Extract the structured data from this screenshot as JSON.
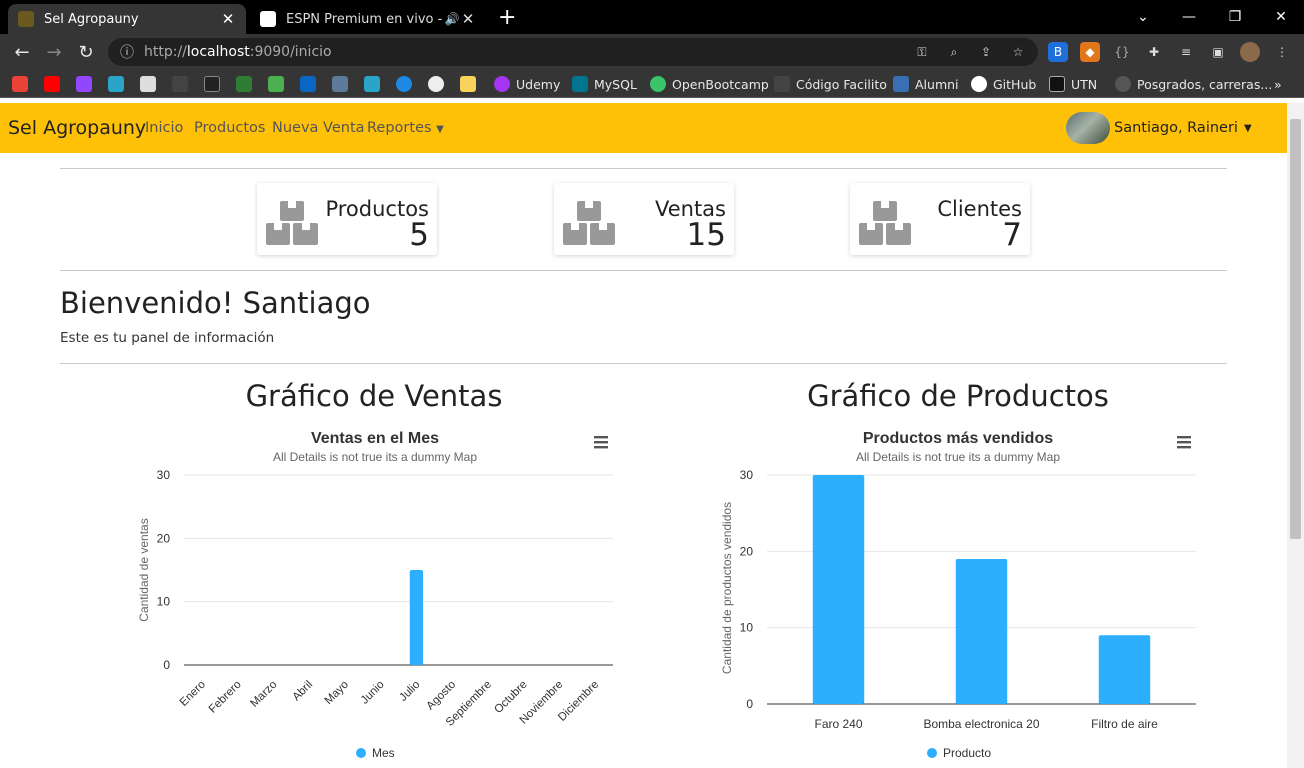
{
  "browser": {
    "tabs": [
      {
        "title": "Sel Agropauny",
        "active": true
      },
      {
        "title": "ESPN Premium en vivo - Fútb",
        "active": false
      }
    ],
    "url_scheme": "http://",
    "url_host": "localhost",
    "url_path": ":9090/inicio",
    "bookmarks": [
      "Udemy",
      "MySQL",
      "OpenBootcamp",
      "Código Facilito",
      "Alumni",
      "GitHub",
      "UTN",
      "Posgrados, carreras..."
    ]
  },
  "navbar": {
    "brand": "Sel Agropauny",
    "links": [
      "Inicio",
      "Productos",
      "Nueva Venta",
      "Reportes"
    ],
    "user": "Santiago, Raineri"
  },
  "cards": [
    {
      "label": "Productos",
      "value": "5"
    },
    {
      "label": "Ventas",
      "value": "15"
    },
    {
      "label": "Clientes",
      "value": "7"
    }
  ],
  "welcome": {
    "title": "Bienvenido! Santiago",
    "subtitle": "Este es tu panel de información"
  },
  "section_titles": {
    "ventas": "Gráfico de Ventas",
    "productos": "Gráfico de Productos"
  },
  "colors": {
    "navbar": "#ffc107",
    "series": "#2caffe"
  },
  "chart_data": [
    {
      "type": "bar",
      "title": "Ventas en el Mes",
      "subtitle": "All Details is not true its a dummy Map",
      "xlabel": "",
      "ylabel": "Cantidad de ventas",
      "ylim": [
        0,
        30
      ],
      "yticks": [
        0,
        10,
        20,
        30
      ],
      "categories": [
        "Enero",
        "Febrero",
        "Marzo",
        "Abril",
        "Mayo",
        "Junio",
        "Julio",
        "Agosto",
        "Septiembre",
        "Octubre",
        "Noviembre",
        "Diciembre"
      ],
      "series": [
        {
          "name": "Mes",
          "values": [
            0,
            0,
            0,
            0,
            0,
            0,
            15,
            0,
            0,
            0,
            0,
            0
          ]
        }
      ],
      "legend": "bottom-center",
      "grid": true
    },
    {
      "type": "bar",
      "title": "Productos más vendidos",
      "subtitle": "All Details is not true its a dummy Map",
      "xlabel": "",
      "ylabel": "Cantidad de productos vendidos",
      "ylim": [
        0,
        30
      ],
      "yticks": [
        0,
        10,
        20,
        30
      ],
      "categories": [
        "Faro 240",
        "Bomba electronica 20",
        "Filtro de aire"
      ],
      "series": [
        {
          "name": "Producto",
          "values": [
            30,
            19,
            9
          ]
        }
      ],
      "legend": "bottom-center",
      "grid": true
    }
  ]
}
